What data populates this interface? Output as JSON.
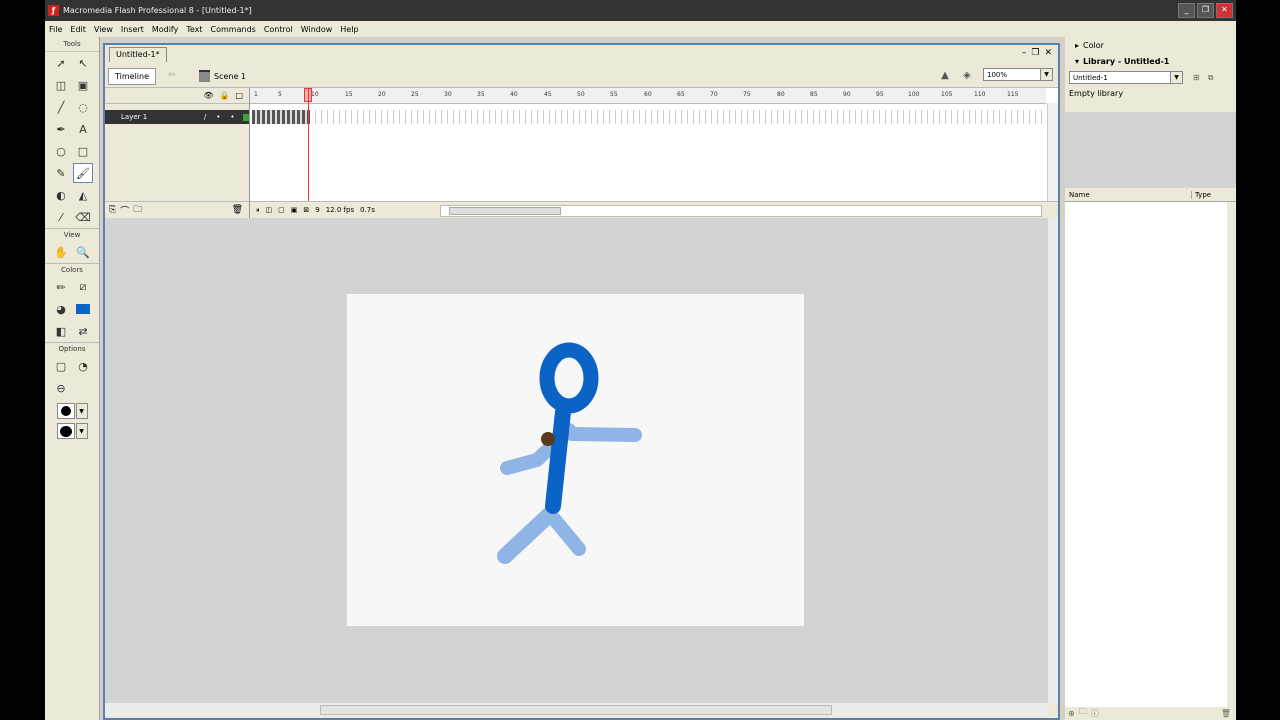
{
  "window": {
    "title": "Macromedia Flash Professional 8 - [Untitled-1*]",
    "app_icon": "flash-icon"
  },
  "menu": [
    "File",
    "Edit",
    "View",
    "Insert",
    "Modify",
    "Text",
    "Commands",
    "Control",
    "Window",
    "Help"
  ],
  "tools": {
    "header": "Tools",
    "view_label": "View",
    "colors_label": "Colors",
    "options_label": "Options"
  },
  "document": {
    "tab": "Untitled-1*",
    "timeline_button": "Timeline",
    "scene": "Scene 1",
    "zoom": "100%"
  },
  "timeline": {
    "layer_name": "Layer 1",
    "ruler": [
      "1",
      "5",
      "10",
      "15",
      "20",
      "25",
      "30",
      "35",
      "40",
      "45",
      "50",
      "55",
      "60",
      "65",
      "70",
      "75",
      "80",
      "85",
      "90",
      "95",
      "100",
      "105",
      "110",
      "115"
    ],
    "current_frame": "9",
    "fps": "12.0 fps",
    "elapsed": "0.7s"
  },
  "panels": {
    "color_title": "Color",
    "library_title": "Library - Untitled-1",
    "library_select": "Untitled-1",
    "library_status": "Empty library",
    "col_name": "Name",
    "col_type": "Type"
  },
  "colors": {
    "stage": "#f7f7f7",
    "figure_dark": "#0b63c5",
    "figure_light": "#8fb4e6",
    "onion_dot": "#5a3a1a"
  }
}
